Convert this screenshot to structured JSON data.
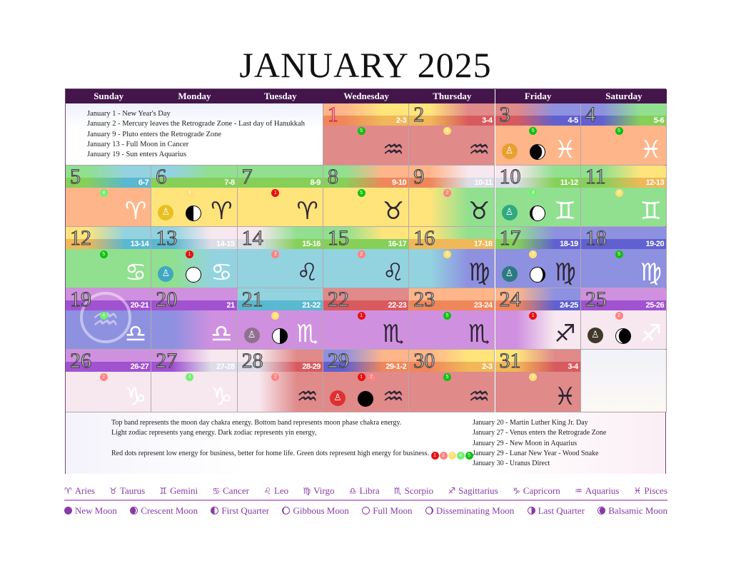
{
  "title": "JANUARY 2025",
  "weekdays": [
    "Sunday",
    "Monday",
    "Tuesday",
    "Wednesday",
    "Thursday",
    "Friday",
    "Saturday"
  ],
  "palette": {
    "R": [
      "#e08a8a",
      "#d95a5e"
    ],
    "O": [
      "#ffb58a",
      "#f0875a"
    ],
    "Y": [
      "#ffe47c",
      "#f0b858"
    ],
    "G": [
      "#90e090",
      "#86d05a"
    ],
    "B": [
      "#93d3e0",
      "#5ab8d0"
    ],
    "I": [
      "#8e90e0",
      "#6060d0"
    ],
    "V": [
      "#d090e0",
      "#a052d0"
    ],
    "W": [
      "#f7e8ef",
      "#dcdde6"
    ]
  },
  "dot_colors": {
    "1": "#e81010",
    "2": "#ff8282",
    "3": "#ffe070",
    "4": "#70f070",
    "5": "#10c010"
  },
  "zodiac_glyphs": {
    "aries": "♈",
    "taurus": "♉",
    "gemini": "♊",
    "cancer": "♋",
    "leo": "♌",
    "virgo": "♍",
    "libra": "♎",
    "scorpio": "♏",
    "sagittarius": "♐",
    "capricorn": "♑",
    "aquarius": "♒",
    "pisces": "♓"
  },
  "top_notes": [
    "January 1 - New Year's Day",
    "January 2 - Mercury leaves the Retrograde Zone - Last day of Hanukkah",
    "January 9 - Pluto enters the Retrograde Zone",
    "January 13 - Full Moon in Cancer",
    "January 19 - Sun enters Aquarius"
  ],
  "bottom_notes": {
    "left": [
      "Top band represents the moon day chakra energy.  Bottom band represents moon phase chakra energy.",
      "Light zodiac represents yang energy. Dark zodiac represents yin energy,",
      "",
      "Red dots represent low energy for business, better for home life. Green dots represent high energy for business."
    ],
    "scale": [
      "1",
      "2",
      "3",
      "4",
      "5"
    ],
    "right": [
      "January 20 - Martin Luther King Jr. Day",
      "January 27 - Venus enters the Retrograde Zone",
      "January 29 - New Moon in Aquarius",
      "January 29 - Lunar New Year - Wood Snake",
      "January 30 - Uranus Direct"
    ]
  },
  "days": [
    {
      "num": "1",
      "range": "2-3",
      "top": "OY",
      "bot": "OY",
      "body": "RR",
      "dots": [
        "5"
      ],
      "sign": "aquarius",
      "tone": "dark"
    },
    {
      "num": "2",
      "range": "3-4",
      "top": "YR",
      "bot": "YR",
      "body": "RR",
      "dots": [
        "3"
      ],
      "sign": "aquarius",
      "tone": "dark"
    },
    {
      "num": "3",
      "range": "4-5",
      "top": "RI",
      "bot": "RI",
      "body": "OO",
      "dots": [
        "5"
      ],
      "sign": "pisces",
      "tone": "light",
      "med": "#e8a030",
      "moon": "crescent"
    },
    {
      "num": "4",
      "range": "5-6",
      "top": "IG",
      "bot": "IG",
      "body": "OO",
      "dots": [
        "5"
      ],
      "sign": "pisces",
      "tone": "light"
    },
    {
      "num": "5",
      "range": "6-7",
      "top": "GB",
      "bot": "GB",
      "body": "OO",
      "dots": [
        "4"
      ],
      "sign": "aries",
      "tone": "light"
    },
    {
      "num": "6",
      "range": "7-8",
      "top": "BG",
      "bot": "GG",
      "body": "YY",
      "dots": [
        "3"
      ],
      "sign": "aries",
      "tone": "dark",
      "med": "#e8c020",
      "moon": "first-quarter"
    },
    {
      "num": "7",
      "range": "8-9",
      "top": "GG",
      "bot": "GG",
      "body": "YY",
      "dots": [
        "1"
      ],
      "sign": "aries",
      "tone": "dark"
    },
    {
      "num": "8",
      "range": "9-10",
      "top": "GO",
      "bot": "GO",
      "body": "YY",
      "dots": [
        "5"
      ],
      "sign": "taurus",
      "tone": "dark"
    },
    {
      "num": "9",
      "range": "10-11",
      "top": "OW",
      "bot": "OW",
      "body": "YG",
      "dots": [
        "2"
      ],
      "sign": "taurus",
      "tone": "dark"
    },
    {
      "num": "10",
      "range": "11-12",
      "top": "WG",
      "bot": "WG",
      "body": "GG",
      "dots": [
        "4"
      ],
      "sign": "gemini",
      "tone": "light",
      "med": "#30a880",
      "moon": "gibbous"
    },
    {
      "num": "11",
      "range": "12-13",
      "top": "GY",
      "bot": "GY",
      "body": "GG",
      "dots": [
        "3"
      ],
      "sign": "gemini",
      "tone": "light"
    },
    {
      "num": "12",
      "range": "13-14",
      "top": "YB",
      "bot": "YB",
      "body": "GG",
      "dots": [
        "5"
      ],
      "sign": "cancer",
      "tone": "light"
    },
    {
      "num": "13",
      "range": "14-15",
      "top": "BW",
      "bot": "BW",
      "body": "GB",
      "dots": [
        "1"
      ],
      "sign": "cancer",
      "tone": "light",
      "med": "#40a8c0",
      "moon": "full"
    },
    {
      "num": "14",
      "range": "15-16",
      "top": "WG",
      "bot": "WG",
      "body": "BB",
      "dots": [
        "2"
      ],
      "sign": "leo",
      "tone": "dark"
    },
    {
      "num": "15",
      "range": "16-17",
      "top": "GY",
      "bot": "GG",
      "body": "BB",
      "dots": [
        "2"
      ],
      "sign": "leo",
      "tone": "dark"
    },
    {
      "num": "16",
      "range": "17-18",
      "top": "YG",
      "bot": "YY",
      "body": "BI",
      "dots": [
        "3"
      ],
      "sign": "virgo",
      "tone": "dark"
    },
    {
      "num": "17",
      "range": "18-19",
      "top": "GI",
      "bot": "GI",
      "body": "II",
      "dots": [
        "3"
      ],
      "sign": "virgo",
      "tone": "dark",
      "med": "#2a7a80",
      "moon": "disseminating"
    },
    {
      "num": "18",
      "range": "19-20",
      "top": "II",
      "bot": "II",
      "body": "II",
      "dots": [
        "5"
      ],
      "sign": "virgo",
      "tone": "light"
    },
    {
      "num": "19",
      "range": "20-21",
      "top": "VV",
      "bot": "VV",
      "body": "II",
      "dots": [
        "4"
      ],
      "sign": "libra",
      "tone": "light",
      "emblem": "aquarius"
    },
    {
      "num": "20",
      "range": "21",
      "top": "VV",
      "bot": "VV",
      "body": "IV",
      "dots": [],
      "sign": "libra",
      "tone": "light"
    },
    {
      "num": "21",
      "range": "21-22",
      "top": "BB",
      "bot": "BB",
      "body": "VV",
      "dots": [
        "3"
      ],
      "sign": "scorpio",
      "tone": "light",
      "med": "#907090",
      "moon": "last-quarter"
    },
    {
      "num": "22",
      "range": "22-23",
      "top": "RR",
      "bot": "RR",
      "body": "VV",
      "dots": [
        "1"
      ],
      "sign": "scorpio",
      "tone": "dark"
    },
    {
      "num": "23",
      "range": "23-24",
      "top": "OO",
      "bot": "OO",
      "body": "VV",
      "dots": [
        "5"
      ],
      "sign": "scorpio",
      "tone": "dark"
    },
    {
      "num": "24",
      "range": "24-25",
      "top": "OI",
      "bot": "OI",
      "body": "VW",
      "dots": [
        "1"
      ],
      "sign": "sagittarius",
      "tone": "dark"
    },
    {
      "num": "25",
      "range": "25-26",
      "top": "VV",
      "bot": "VV",
      "body": "WW",
      "dots": [
        "2"
      ],
      "sign": "sagittarius",
      "tone": "light",
      "med": "#403828",
      "moon": "balsamic"
    },
    {
      "num": "26",
      "range": "26-27",
      "top": "VV",
      "bot": "VV",
      "body": "WW",
      "dots": [
        "2"
      ],
      "sign": "capricorn",
      "tone": "light"
    },
    {
      "num": "27",
      "range": "27-28",
      "top": "VW",
      "bot": "VW",
      "body": "WW",
      "dots": [
        "4"
      ],
      "sign": "capricorn",
      "tone": "light"
    },
    {
      "num": "28",
      "range": "28-29",
      "top": "WR",
      "bot": "WR",
      "body": "WR",
      "dots": [
        "2"
      ],
      "sign": "aquarius",
      "tone": "dark"
    },
    {
      "num": "29",
      "range": "29-1-2",
      "top": "IO",
      "bot": "IO",
      "body": "RR",
      "dots": [
        "1",
        "2"
      ],
      "sign": "aquarius",
      "tone": "dark",
      "med": "#e03030",
      "moon": "new"
    },
    {
      "num": "30",
      "range": "2-3",
      "top": "OY",
      "bot": "OY",
      "body": "RR",
      "dots": [
        "5"
      ],
      "sign": "aquarius",
      "tone": "dark"
    },
    {
      "num": "31",
      "range": "3-4",
      "top": "YR",
      "bot": "YR",
      "body": "RR",
      "dots": [
        "3"
      ],
      "sign": "pisces",
      "tone": "dark"
    }
  ],
  "legend": {
    "zodiac": [
      {
        "sign": "aries",
        "label": "Aries"
      },
      {
        "sign": "taurus",
        "label": "Taurus"
      },
      {
        "sign": "gemini",
        "label": "Gemini"
      },
      {
        "sign": "cancer",
        "label": "Cancer"
      },
      {
        "sign": "leo",
        "label": "Leo"
      },
      {
        "sign": "virgo",
        "label": "Virgo"
      },
      {
        "sign": "libra",
        "label": "Libra"
      },
      {
        "sign": "scorpio",
        "label": "Scorpio"
      },
      {
        "sign": "sagittarius",
        "label": "Sagittarius"
      },
      {
        "sign": "capricorn",
        "label": "Capricorn"
      },
      {
        "sign": "aquarius",
        "label": "Aquarius"
      },
      {
        "sign": "pisces",
        "label": "Pisces"
      }
    ],
    "moons": [
      {
        "phase": "new",
        "label": "New Moon"
      },
      {
        "phase": "crescent",
        "label": "Crescent Moon"
      },
      {
        "phase": "first-quarter",
        "label": "First Quarter"
      },
      {
        "phase": "gibbous",
        "label": "Gibbous Moon"
      },
      {
        "phase": "full",
        "label": "Full Moon"
      },
      {
        "phase": "disseminating",
        "label": "Disseminating Moon"
      },
      {
        "phase": "last-quarter",
        "label": "Last Quarter"
      },
      {
        "phase": "balsamic",
        "label": "Balsamic Moon"
      }
    ]
  }
}
